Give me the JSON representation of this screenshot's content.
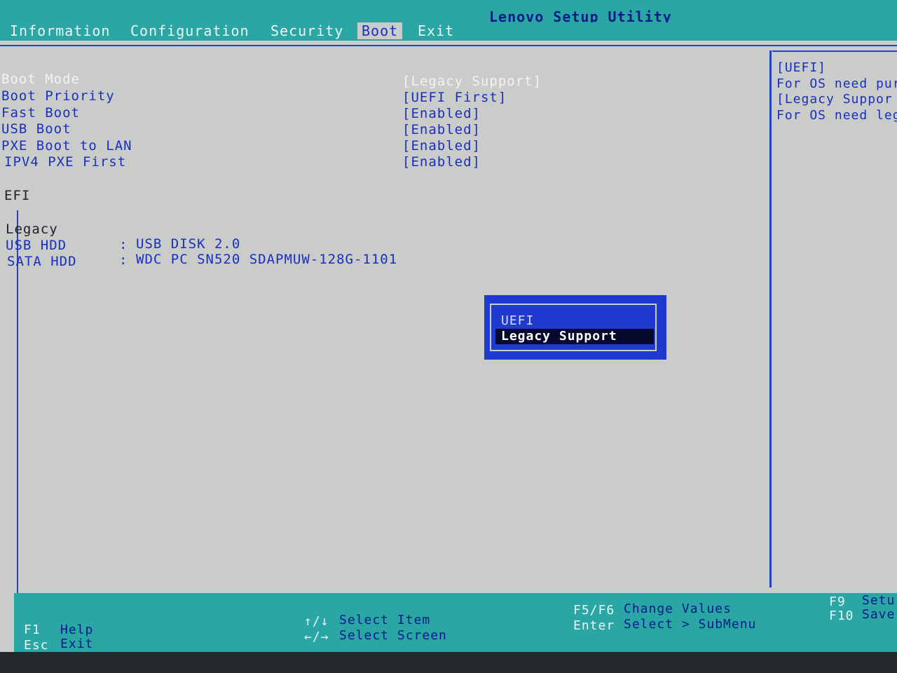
{
  "header": {
    "title": "Lenovo Setup Utility",
    "tabs": [
      {
        "label": "Information"
      },
      {
        "label": "Configuration"
      },
      {
        "label": "Security"
      },
      {
        "label": "Boot"
      },
      {
        "label": "Exit"
      }
    ]
  },
  "settings": [
    {
      "label": "Boot Mode",
      "value": "[Legacy Support]"
    },
    {
      "label": "Boot Priority",
      "value": "[UEFI First]"
    },
    {
      "label": "Fast Boot",
      "value": "[Enabled]"
    },
    {
      "label": "USB Boot",
      "value": "[Enabled]"
    },
    {
      "label": "PXE Boot to LAN",
      "value": "[Enabled]"
    },
    {
      "label": "IPV4 PXE First",
      "value": "[Enabled]"
    }
  ],
  "efi_header": "EFI",
  "legacy": {
    "header": "Legacy",
    "separator": ":",
    "devices": [
      {
        "type": "USB HDD",
        "name": "USB DISK 2.0"
      },
      {
        "type": "SATA HDD",
        "name": "WDC PC SN520 SDAPMUW-128G-1101"
      }
    ]
  },
  "help": {
    "lines": [
      "[UEFI]",
      "For OS need pur",
      "[Legacy Suppor",
      "For OS need leg"
    ]
  },
  "popup": {
    "options": [
      {
        "label": "UEFI"
      },
      {
        "label": "Legacy Support"
      }
    ],
    "selected": "Legacy Support"
  },
  "footer": {
    "f1_key": "F1",
    "f1_desc": "Help",
    "esc_key": "Esc",
    "esc_desc": "Exit",
    "updown_key": "↑/↓",
    "updown_desc": "Select Item",
    "leftright_key": "←/→",
    "leftright_desc": "Select Screen",
    "f5f6_key": "F5/F6",
    "f5f6_desc": "Change Values",
    "enter_key": "Enter",
    "enter_desc": "Select > SubMenu",
    "f9_key": "F9",
    "f9_desc": "Setu",
    "f10_key": "F10",
    "f10_desc": "Save"
  },
  "colors": {
    "bar": "#2aa6a4",
    "background": "#c9ccc9",
    "text_blue": "#1a2fc0",
    "popup_blue": "#1f3ad0"
  }
}
